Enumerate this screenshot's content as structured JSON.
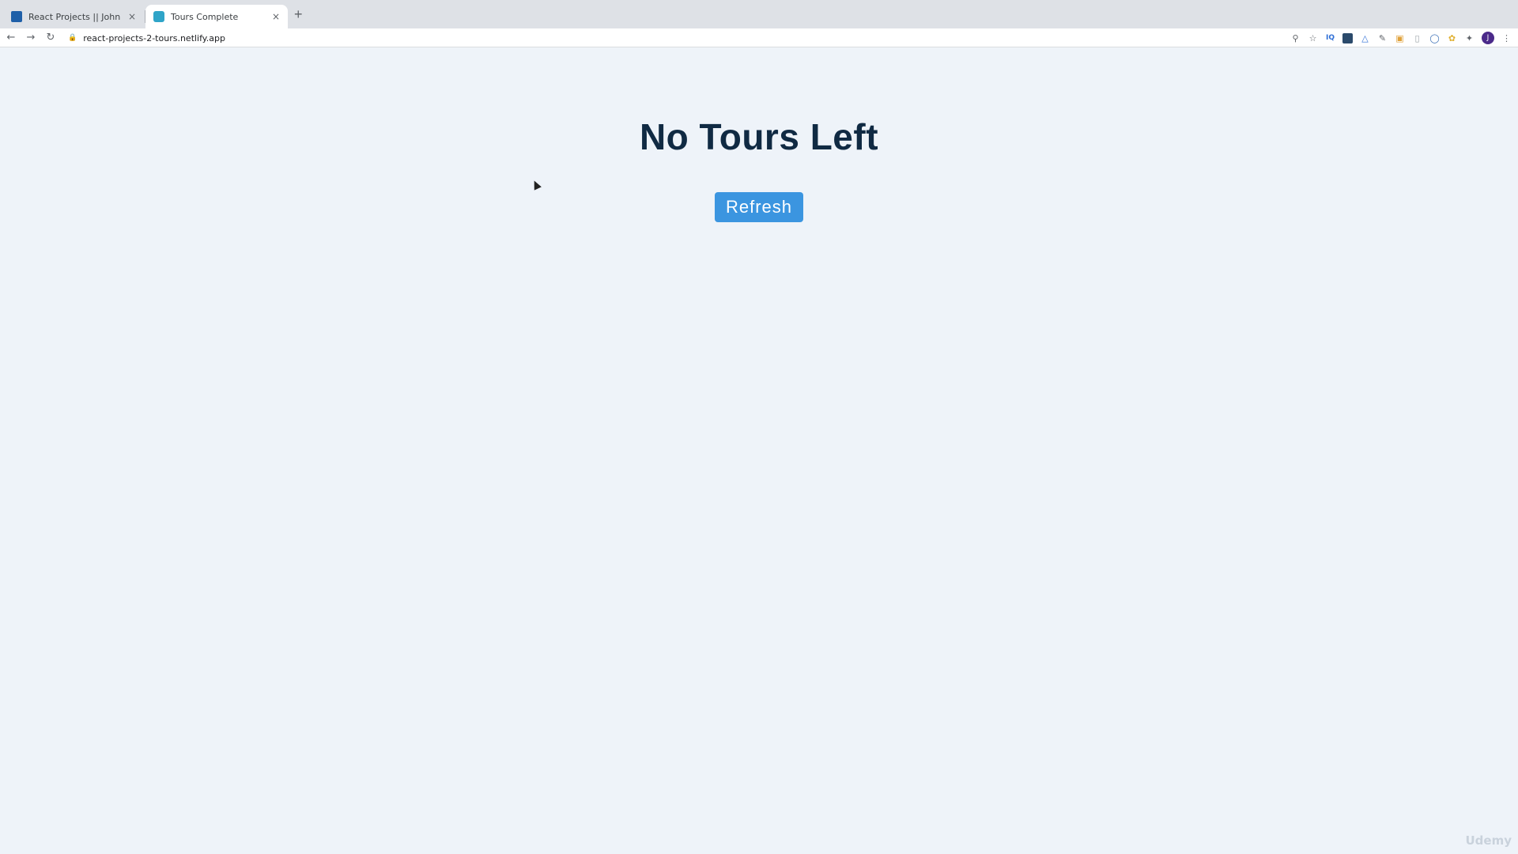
{
  "browser": {
    "tabs": [
      {
        "title": "React Projects || John Smilga",
        "active": false
      },
      {
        "title": "Tours Complete",
        "active": true
      }
    ],
    "new_tab": "+",
    "close_glyph": "×",
    "url": "react-projects-2-tours.netlify.app",
    "nav": {
      "back": "←",
      "forward": "→",
      "reload": "↻"
    },
    "extension_icons": [
      "zoom-icon",
      "star-icon",
      "ext-iq-icon",
      "ext-square-icon",
      "ext-triangle-icon",
      "ext-pen-icon",
      "ext-calendar-icon",
      "ext-doc-icon",
      "ext-circle-icon",
      "ext-leaf-icon",
      "puzzle-icon",
      "avatar-icon",
      "menu-icon"
    ],
    "avatar_letter": "J"
  },
  "page": {
    "title": "No Tours Left",
    "refresh_label": "Refresh"
  },
  "watermark": "Udemy",
  "colors": {
    "page_bg": "#eef3f9",
    "title": "#102a43",
    "button_bg": "#3b95e0",
    "button_text": "#ffffff"
  }
}
